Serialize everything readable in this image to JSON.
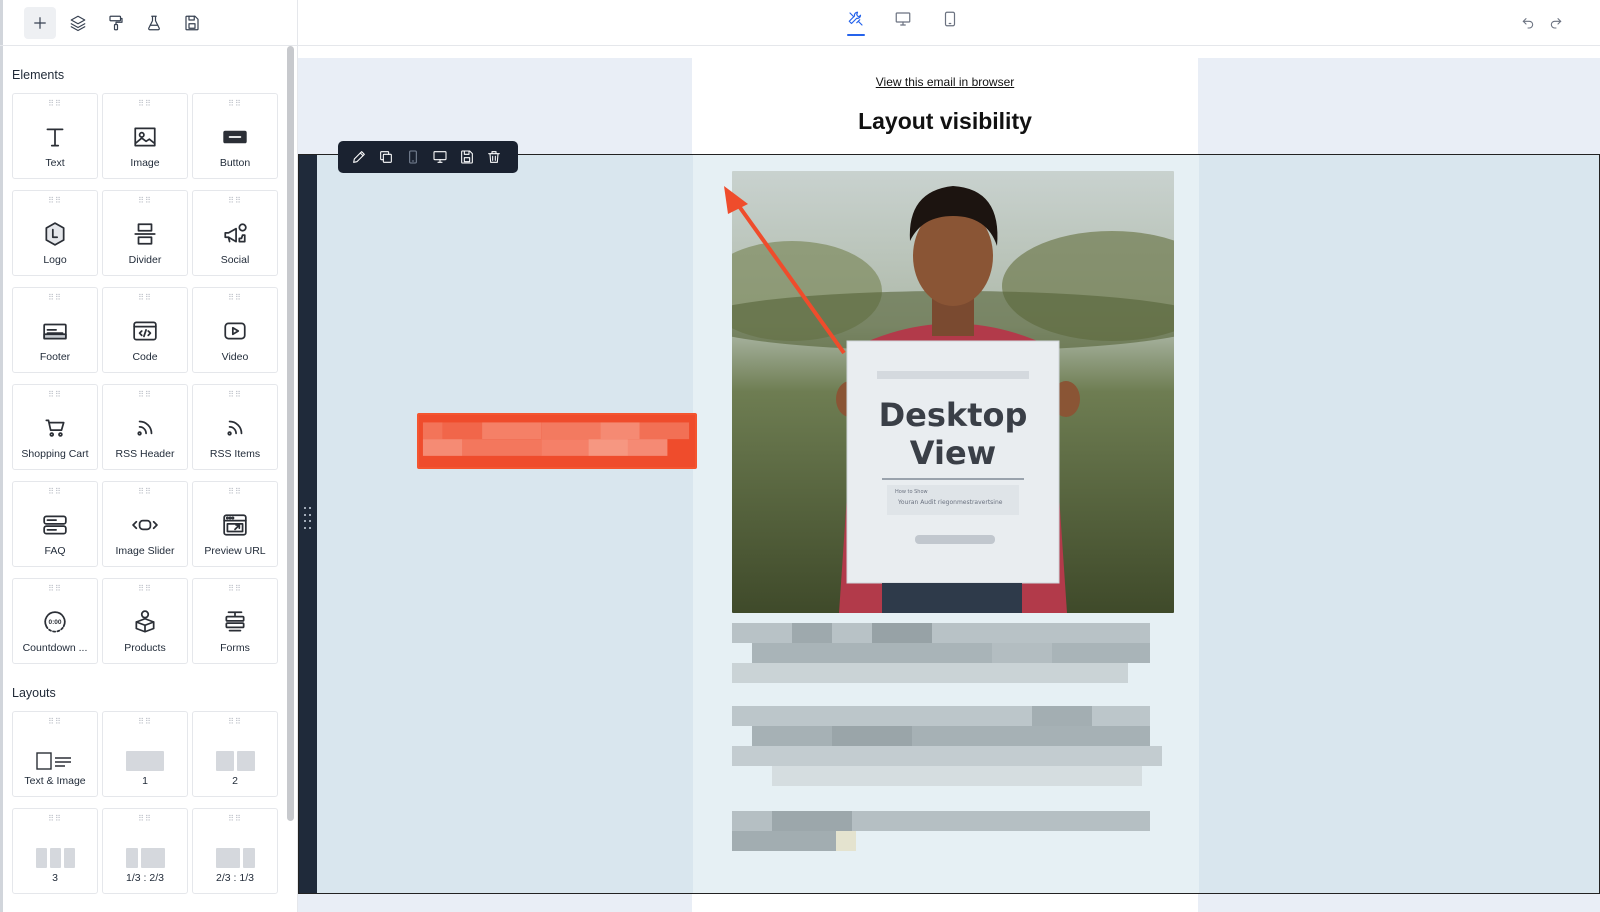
{
  "sidebar": {
    "toolbar": [
      {
        "name": "add-icon",
        "active": true
      },
      {
        "name": "layers-icon",
        "active": false
      },
      {
        "name": "paint-roller-icon",
        "active": false
      },
      {
        "name": "flask-icon",
        "active": false
      },
      {
        "name": "save-icon",
        "active": false
      }
    ],
    "elements_title": "Elements",
    "elements": [
      {
        "label": "Text",
        "icon": "text-icon"
      },
      {
        "label": "Image",
        "icon": "image-icon"
      },
      {
        "label": "Button",
        "icon": "button-icon"
      },
      {
        "label": "Logo",
        "icon": "logo-icon"
      },
      {
        "label": "Divider",
        "icon": "divider-icon"
      },
      {
        "label": "Social",
        "icon": "social-icon"
      },
      {
        "label": "Footer",
        "icon": "footer-icon"
      },
      {
        "label": "Code",
        "icon": "code-icon"
      },
      {
        "label": "Video",
        "icon": "video-icon"
      },
      {
        "label": "Shopping Cart",
        "icon": "cart-icon"
      },
      {
        "label": "RSS Header",
        "icon": "rss-icon"
      },
      {
        "label": "RSS Items",
        "icon": "rss-icon"
      },
      {
        "label": "FAQ",
        "icon": "faq-icon"
      },
      {
        "label": "Image Slider",
        "icon": "slider-icon"
      },
      {
        "label": "Preview URL",
        "icon": "preview-url-icon"
      },
      {
        "label": "Countdown ...",
        "icon": "countdown-icon"
      },
      {
        "label": "Products",
        "icon": "products-icon"
      },
      {
        "label": "Forms",
        "icon": "forms-icon"
      }
    ],
    "layouts_title": "Layouts",
    "layouts": [
      {
        "label": "Text & Image"
      },
      {
        "label": "1"
      },
      {
        "label": "2"
      },
      {
        "label": "3"
      },
      {
        "label": "1/3 : 2/3"
      },
      {
        "label": "2/3 : 1/3"
      }
    ]
  },
  "topbar": {
    "views": [
      {
        "name": "edit-view-icon",
        "active": true
      },
      {
        "name": "desktop-view-icon",
        "active": false
      },
      {
        "name": "mobile-view-icon",
        "active": false
      }
    ],
    "undo": "undo-icon",
    "redo": "redo-icon"
  },
  "email": {
    "view_link": "View this email in browser",
    "title": "Layout visibility",
    "image_caption_line1": "Desktop",
    "image_caption_line2": "View",
    "image_small_text1": "How to Show",
    "image_small_text2": "Youran Audit riegonmestravertsine"
  },
  "row_toolbar": [
    {
      "name": "edit-icon"
    },
    {
      "name": "duplicate-icon"
    },
    {
      "name": "mobile-visibility-icon"
    },
    {
      "name": "desktop-visibility-icon"
    },
    {
      "name": "save-row-icon"
    },
    {
      "name": "delete-icon"
    }
  ],
  "colors": {
    "accent": "#2563eb",
    "annotation": "#ef4c2c",
    "row_toolbar_bg": "#1a2230"
  }
}
